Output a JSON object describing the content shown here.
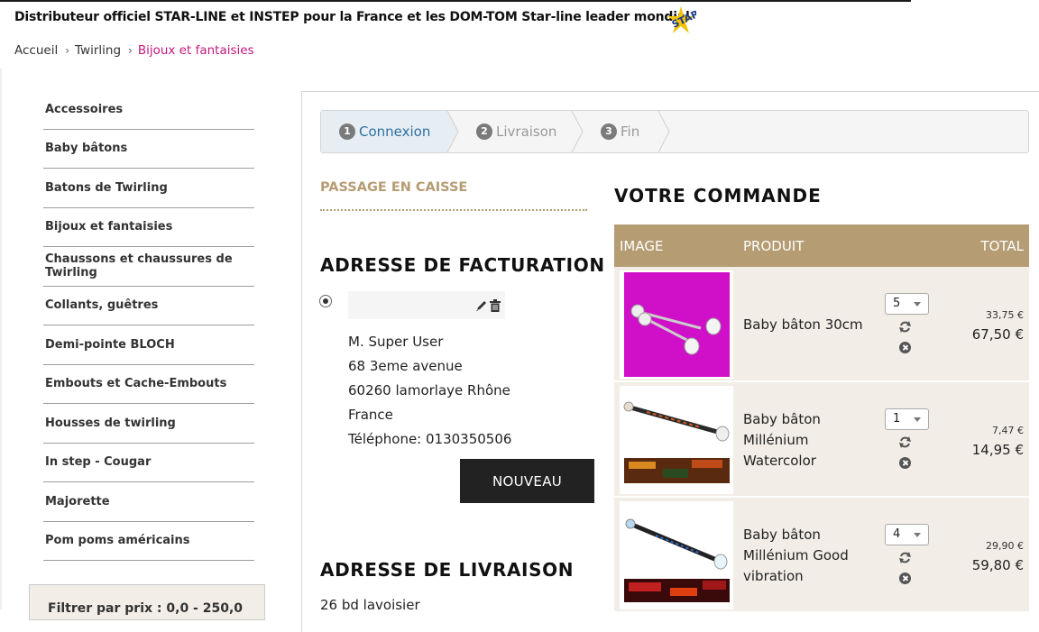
{
  "header": {
    "title": "Distributeur officiel STAR-LINE et INSTEP pour la France et les DOM-TOM Star-line leader mondial"
  },
  "breadcrumb": {
    "items": [
      "Accueil",
      "Twirling",
      "Bijoux et fantaisies"
    ]
  },
  "sidebar": {
    "items": [
      "Accessoires",
      "Baby bâtons",
      "Batons de Twirling",
      "Bijoux et fantaisies",
      "Chaussons et chaussures de Twirling",
      "Collants, guêtres",
      "Demi-pointe BLOCH",
      "Embouts et Cache-Embouts",
      "Housses de twirling",
      "In step - Cougar",
      "Majorette",
      "Pom poms américains"
    ],
    "filter_label": "Filtrer par prix : 0,0 - 250,0"
  },
  "steps": [
    {
      "num": "1",
      "label": "Connexion"
    },
    {
      "num": "2",
      "label": "Livraison"
    },
    {
      "num": "3",
      "label": "Fin"
    }
  ],
  "checkout": {
    "section_label": "PASSAGE EN CAISSE",
    "billing_title": "ADRESSE DE FACTURATION",
    "address": [
      "M. Super User",
      "68 3eme avenue",
      "60260 lamorlaye Rhône",
      "France",
      "Téléphone: 0130350506"
    ],
    "new_button": "NOUVEAU",
    "shipping_title": "ADRESSE DE LIVRAISON",
    "shipping_line": "26 bd lavoisier"
  },
  "order": {
    "title": "VOTRE COMMANDE",
    "columns": {
      "image": "IMAGE",
      "product": "PRODUIT",
      "total": "TOTAL"
    },
    "rows": [
      {
        "name": "Baby bâton 30cm",
        "qty": "5",
        "unit": "33,75 €",
        "total": "67,50 €"
      },
      {
        "name": "Baby bâton Millénium Watercolor",
        "qty": "1",
        "unit": "7,47 €",
        "total": "14,95 €"
      },
      {
        "name": "Baby bâton Millénium Good vibration",
        "qty": "4",
        "unit": "29,90 €",
        "total": "59,80 €"
      }
    ]
  },
  "colors": {
    "accent": "#b59c73",
    "breadcrumb_active": "#c0187e",
    "step_active": "#2e6f9e"
  },
  "icons": [
    "starline-logo",
    "chevron-right-icon",
    "edit-icon",
    "trash-icon",
    "refresh-icon",
    "remove-icon"
  ]
}
